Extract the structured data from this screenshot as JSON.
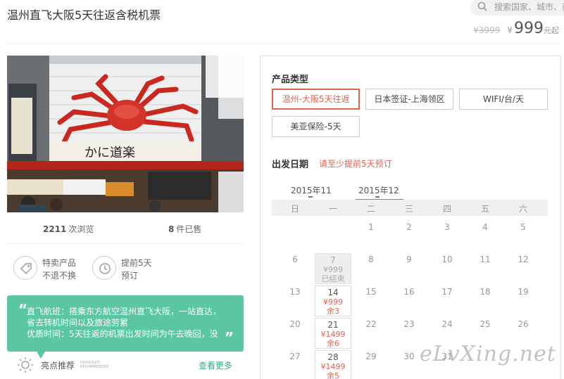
{
  "header": {
    "title": "温州直飞大阪5天往返含税机票",
    "search_placeholder": "搜索国家、城市、商",
    "old_price": "¥3999",
    "currency": "¥",
    "price": "999",
    "price_unit": "元起"
  },
  "stats": {
    "views_count": "2211",
    "views_label": "次浏览",
    "sold_count": "8",
    "sold_label": "件已售"
  },
  "features": [
    {
      "icon": "tag-icon",
      "line1": "特卖产品",
      "line2": "不退不换"
    },
    {
      "icon": "clock-icon",
      "line1": "提前5天",
      "line2": "预订"
    }
  ],
  "quote": {
    "open_mark": "“",
    "close_mark": "”",
    "lines": [
      "直飞航班：搭乘东方航空温州直飞大阪，一站直达，",
      "省去转机时间以及旅途劳累",
      "优质时间：5天往返的机票出发时间为午去晚回，没"
    ]
  },
  "highlight": {
    "label": "亮点推荐",
    "label_en": "HIGHLIGHT RECOMMENDED",
    "more": "查看更多"
  },
  "product": {
    "type_label": "产品类型",
    "options": [
      {
        "label": "温州-大阪5天往返",
        "active": true
      },
      {
        "label": "日本签证-上海领区",
        "active": false
      },
      {
        "label": "WIFI/台/天",
        "active": false
      },
      {
        "label": "美亚保险-5天",
        "active": false
      }
    ]
  },
  "calendar": {
    "date_label": "出发日期",
    "hint": "请至少提前5天预订",
    "months": [
      {
        "label": "2015年11",
        "active": false
      },
      {
        "label": "2015年12",
        "active": true
      }
    ],
    "weekdays": [
      "日",
      "一",
      "二",
      "三",
      "四",
      "五",
      "六"
    ],
    "rows": [
      [
        {
          "d": ""
        },
        {
          "d": ""
        },
        {
          "d": "1"
        },
        {
          "d": "2"
        },
        {
          "d": "3"
        },
        {
          "d": "4"
        },
        {
          "d": "5"
        }
      ],
      [
        {
          "d": "6"
        },
        {
          "d": "7",
          "price": "¥999",
          "note": "已结束",
          "state": "closed"
        },
        {
          "d": "8"
        },
        {
          "d": "9"
        },
        {
          "d": "10"
        },
        {
          "d": "11"
        },
        {
          "d": "12"
        }
      ],
      [
        {
          "d": "13"
        },
        {
          "d": "14",
          "price": "¥999",
          "note": "余3",
          "state": "available"
        },
        {
          "d": "15"
        },
        {
          "d": "16"
        },
        {
          "d": "17"
        },
        {
          "d": "18"
        },
        {
          "d": "19"
        }
      ],
      [
        {
          "d": "20"
        },
        {
          "d": "21",
          "price": "¥1499",
          "note": "余6",
          "state": "available"
        },
        {
          "d": "22"
        },
        {
          "d": "23"
        },
        {
          "d": "24"
        },
        {
          "d": "25"
        },
        {
          "d": "26"
        }
      ],
      [
        {
          "d": "27"
        },
        {
          "d": "28",
          "price": "¥1499",
          "note": "余5",
          "state": "available"
        },
        {
          "d": "29"
        },
        {
          "d": "30"
        },
        {
          "d": "31"
        },
        {
          "d": ""
        },
        {
          "d": ""
        }
      ]
    ]
  },
  "watermark": "eLvXing.net",
  "colors": {
    "accent": "#e1634f",
    "green": "#5bc7a2",
    "link_green": "#3aaa86"
  }
}
